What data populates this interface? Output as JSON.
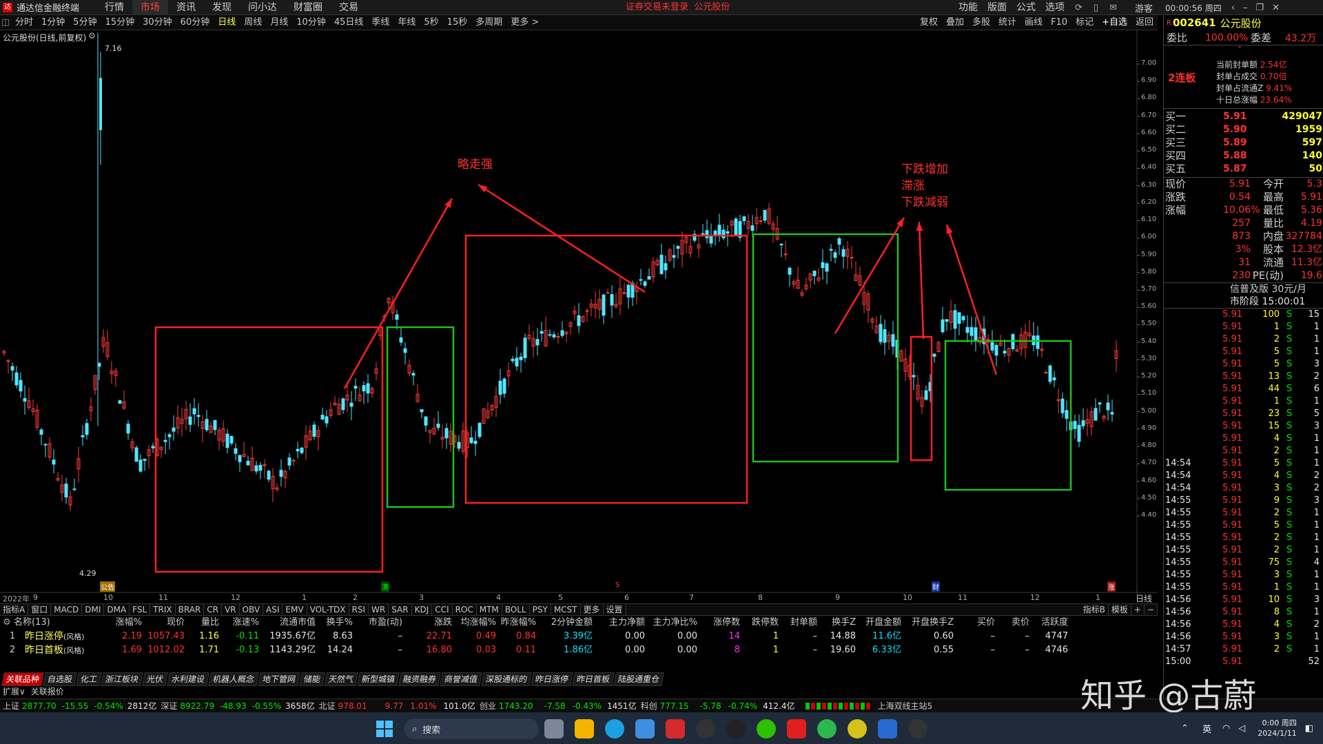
{
  "menubar": {
    "app_title": "通达信金融终端",
    "items": [
      "行情",
      "市场",
      "资讯",
      "发现",
      "问小达",
      "财富圈",
      "交易"
    ],
    "active_index": 1,
    "notice": "证券交易未登录  公元股份",
    "right_items": [
      "功能",
      "版面",
      "公式",
      "选项"
    ],
    "user": "游客",
    "clock": "00:00:56 周四"
  },
  "periodbar": {
    "items": [
      "分时",
      "1分钟",
      "5分钟",
      "15分钟",
      "30分钟",
      "60分钟",
      "日线",
      "周线",
      "月线",
      "10分钟",
      "45日线",
      "季线",
      "年线",
      "5秒",
      "15秒",
      "多周期",
      "更多 >"
    ],
    "active_index": 6,
    "tools": [
      "复权",
      "叠加",
      "多股",
      "统计",
      "画线",
      "F10",
      "标记",
      "+自选",
      "返回"
    ]
  },
  "chart": {
    "title": "公元股份(日线,前复权)",
    "max_label": "7.16",
    "min_label": "4.29",
    "y_ticks": [
      "7.00",
      "6.90",
      "6.80",
      "6.70",
      "6.60",
      "6.50",
      "6.40",
      "6.30",
      "6.20",
      "6.10",
      "6.00",
      "5.90",
      "5.80",
      "5.70",
      "5.60",
      "5.50",
      "5.40",
      "5.30",
      "5.20",
      "5.10",
      "5.00",
      "4.90",
      "4.80",
      "4.70",
      "4.60",
      "4.50",
      "4.40"
    ],
    "x_ticks": [
      "2022年",
      "9",
      "10",
      "11",
      "12",
      "1",
      "2",
      "3",
      "4",
      "5",
      "6",
      "7",
      "8",
      "9",
      "10",
      "11",
      "12",
      "1"
    ],
    "annotations": {
      "a1": "略走强",
      "a2_line1": "下跌增加",
      "a2_line2": "滞涨",
      "a2_line3": "下跌减弱"
    },
    "markers": [
      "公告",
      "港",
      "S",
      "财",
      "涨"
    ],
    "period_label": "日线"
  },
  "right_panel": {
    "code": "002641",
    "name": "公元股份",
    "weibi_label": "委比",
    "weibi_value": "100.00%",
    "weicha_label": "委差",
    "weicha_value": "43.2万",
    "board_label": "2连板",
    "board_info": [
      {
        "label": "当前封单额",
        "value": "2.54亿"
      },
      {
        "label": "封单占成交",
        "value": "0.70倍"
      },
      {
        "label": "封单占流通Z",
        "value": "9.41%"
      },
      {
        "label": "十日总涨幅",
        "value": "23.64%"
      }
    ],
    "bids": [
      {
        "label": "买一",
        "price": "5.91",
        "vol": "429047"
      },
      {
        "label": "买二",
        "price": "5.90",
        "vol": "1959"
      },
      {
        "label": "买三",
        "price": "5.89",
        "vol": "597"
      },
      {
        "label": "买四",
        "price": "5.88",
        "vol": "140"
      },
      {
        "label": "买五",
        "price": "5.87",
        "vol": "50"
      }
    ],
    "quote": [
      {
        "l1": "现价",
        "v1": "5.91",
        "l2": "今开",
        "v2": "5.3"
      },
      {
        "l1": "涨跌",
        "v1": "0.54",
        "l2": "最高",
        "v2": "5.91"
      },
      {
        "l1": "涨幅",
        "v1": "10.06%",
        "l2": "最低",
        "v2": "5.36"
      },
      {
        "l1": "",
        "v1": "257",
        "l2": "量比",
        "v2": "4.19"
      },
      {
        "l1": "",
        "v1": "873",
        "l2": "内盘",
        "v2": "327784"
      },
      {
        "l1": "",
        "v1": "3%",
        "l2": "股本",
        "v2": "12.3亿"
      },
      {
        "l1": "",
        "v1": "31",
        "l2": "流通",
        "v2": "11.3亿"
      },
      {
        "l1": "",
        "v1": "230",
        "l2": "PE(动)",
        "v2": "19.6"
      }
    ],
    "promo": "信普及版  30元/月",
    "session": "市阶段 15:00:01",
    "ticks": [
      {
        "t": "",
        "p": "5.91",
        "v": "100",
        "f": "S",
        "n": "15"
      },
      {
        "t": "",
        "p": "5.91",
        "v": "1",
        "f": "S",
        "n": "1"
      },
      {
        "t": "",
        "p": "5.91",
        "v": "2",
        "f": "S",
        "n": "1"
      },
      {
        "t": "",
        "p": "5.91",
        "v": "5",
        "f": "S",
        "n": "1"
      },
      {
        "t": "",
        "p": "5.91",
        "v": "5",
        "f": "S",
        "n": "3"
      },
      {
        "t": "",
        "p": "5.91",
        "v": "13",
        "f": "S",
        "n": "2"
      },
      {
        "t": "",
        "p": "5.91",
        "v": "44",
        "f": "S",
        "n": "6"
      },
      {
        "t": "",
        "p": "5.91",
        "v": "1",
        "f": "S",
        "n": "1"
      },
      {
        "t": "",
        "p": "5.91",
        "v": "23",
        "f": "S",
        "n": "5"
      },
      {
        "t": "",
        "p": "5.91",
        "v": "15",
        "f": "S",
        "n": "3"
      },
      {
        "t": "",
        "p": "5.91",
        "v": "4",
        "f": "S",
        "n": "1"
      },
      {
        "t": "",
        "p": "5.91",
        "v": "2",
        "f": "S",
        "n": "1"
      },
      {
        "t": "14:54",
        "p": "5.91",
        "v": "5",
        "f": "S",
        "n": "1"
      },
      {
        "t": "14:54",
        "p": "5.91",
        "v": "4",
        "f": "S",
        "n": "2"
      },
      {
        "t": "14:54",
        "p": "5.91",
        "v": "3",
        "f": "S",
        "n": "2"
      },
      {
        "t": "14:55",
        "p": "5.91",
        "v": "9",
        "f": "S",
        "n": "3"
      },
      {
        "t": "14:55",
        "p": "5.91",
        "v": "2",
        "f": "S",
        "n": "1"
      },
      {
        "t": "14:55",
        "p": "5.91",
        "v": "5",
        "f": "S",
        "n": "1"
      },
      {
        "t": "14:55",
        "p": "5.91",
        "v": "2",
        "f": "S",
        "n": "1"
      },
      {
        "t": "14:55",
        "p": "5.91",
        "v": "2",
        "f": "S",
        "n": "1"
      },
      {
        "t": "14:55",
        "p": "5.91",
        "v": "75",
        "f": "S",
        "n": "4"
      },
      {
        "t": "14:55",
        "p": "5.91",
        "v": "3",
        "f": "S",
        "n": "1"
      },
      {
        "t": "14:55",
        "p": "5.91",
        "v": "1",
        "f": "S",
        "n": "1"
      },
      {
        "t": "14:56",
        "p": "5.91",
        "v": "10",
        "f": "S",
        "n": "3"
      },
      {
        "t": "14:56",
        "p": "5.91",
        "v": "8",
        "f": "S",
        "n": "1"
      },
      {
        "t": "14:56",
        "p": "5.91",
        "v": "4",
        "f": "S",
        "n": "2"
      },
      {
        "t": "14:56",
        "p": "5.91",
        "v": "3",
        "f": "S",
        "n": "1"
      },
      {
        "t": "14:57",
        "p": "5.91",
        "v": "2",
        "f": "S",
        "n": "1"
      },
      {
        "t": "15:00",
        "p": "5.91",
        "v": "",
        "f": "",
        "n": "52"
      }
    ]
  },
  "indicator_tabs": [
    "指标A",
    "窗口",
    "MACD",
    "DMI",
    "DMA",
    "FSL",
    "TRIX",
    "BRAR",
    "CR",
    "VR",
    "OBV",
    "ASI",
    "EMV",
    "VOL-TDX",
    "RSI",
    "WR",
    "SAR",
    "KDJ",
    "CCI",
    "ROC",
    "MTM",
    "BOLL",
    "PSY",
    "MCST",
    "更多",
    "设置"
  ],
  "indicator_right": [
    "指标B",
    "模板",
    "+",
    "−"
  ],
  "table": {
    "headers": [
      "名称(13)",
      "涨幅%",
      "现价",
      "量比",
      "涨速%",
      "流通市值",
      "换手%",
      "市盈(动)",
      "涨跌",
      "均涨幅%",
      "昨涨幅%",
      "2分钟金额",
      "主力净额",
      "主力净比%",
      "涨停数",
      "跌停数",
      "封单额",
      "换手Z",
      "开盘金额",
      "开盘换手Z",
      "买价",
      "卖价",
      "活跃度"
    ],
    "rows": [
      [
        "1",
        "昨日涨停",
        "(风格)",
        "2.19",
        "1057.43",
        "1.16",
        "-0.11",
        "1935.67亿",
        "8.63",
        "–",
        "22.71",
        "0.49",
        "0.84",
        "3.39亿",
        "0.00",
        "0.00",
        "14",
        "1",
        "–",
        "14.88",
        "11.6亿",
        "0.60",
        "–",
        "–",
        "4747"
      ],
      [
        "2",
        "昨日首板",
        "(风格)",
        "1.69",
        "1012.02",
        "1.71",
        "-0.13",
        "1143.29亿",
        "14.24",
        "–",
        "16.80",
        "0.03",
        "0.11",
        "1.86亿",
        "0.00",
        "0.00",
        "8",
        "1",
        "–",
        "19.60",
        "6.33亿",
        "0.55",
        "–",
        "–",
        "4746"
      ]
    ]
  },
  "sectors": [
    "关联品种",
    "自选股",
    "化工",
    "浙江板块",
    "光伏",
    "水利建设",
    "机器人概念",
    "地下管网",
    "储能",
    "天然气",
    "新型城镇",
    "融资融券",
    "商誉减值",
    "深股通标的",
    "昨日涨停",
    "昨日首板",
    "陆股通重仓"
  ],
  "sub_tabs": [
    "扩展∨",
    "关联报价"
  ],
  "status": {
    "sh_label": "上证",
    "sh": "2877.70",
    "sh_chg": "-15.55",
    "sh_pct": "-0.54%",
    "sh_amt": "2812亿",
    "sz_label": "深证",
    "sz": "8922.79",
    "sz_chg": "-48.93",
    "sz_pct": "-0.55%",
    "sz_amt": "3658亿",
    "bz_label": "北证",
    "bz": "978.01",
    "bz_chg": "9.77",
    "bz_pct": "1.01%",
    "bz_amt": "101.0亿",
    "cy_label": "创业",
    "cy": "1743.20",
    "cy_chg": "-7.58",
    "cy_pct": "-0.43%",
    "cy_amt": "1451亿",
    "kc_label": "科创",
    "kc": "777.15",
    "kc_chg": "-5.78",
    "kc_pct": "-0.74%",
    "kc_amt": "412.4亿",
    "server": "上海双线主站5"
  },
  "taskbar": {
    "search": "搜索",
    "ime": "英",
    "time": "0:00 周四",
    "date": "2024/1/11"
  },
  "watermark": "知乎 @古蔚"
}
